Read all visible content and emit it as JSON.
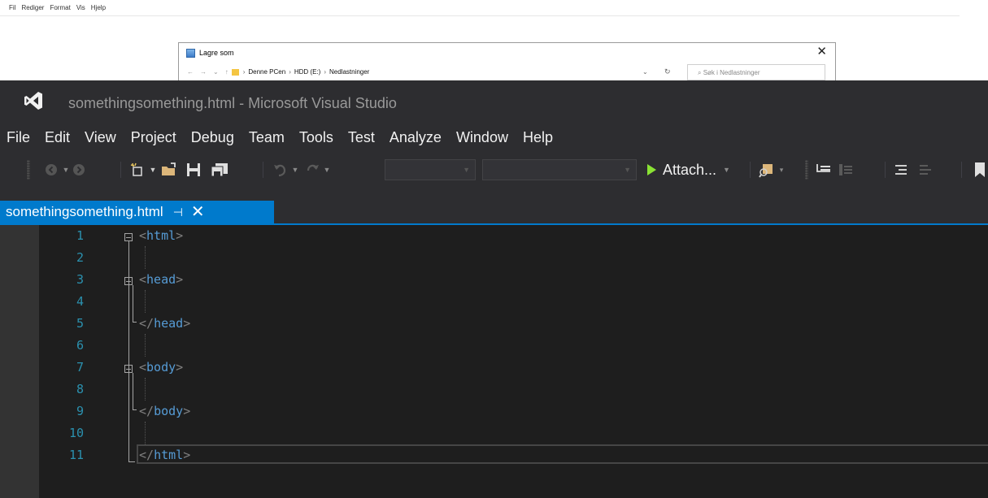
{
  "notepad": {
    "menu": [
      "Fil",
      "Rediger",
      "Format",
      "Vis",
      "Hjelp"
    ]
  },
  "save_dialog": {
    "title": "Lagre som",
    "close": "✕",
    "breadcrumb": [
      "Denne PCen",
      "HDD (E:)",
      "Nedlastninger"
    ],
    "search_placeholder": "Søk i Nedlastninger"
  },
  "vs": {
    "title": "somethingsomething.html - Microsoft Visual Studio",
    "menu": [
      "File",
      "Edit",
      "View",
      "Project",
      "Debug",
      "Team",
      "Tools",
      "Test",
      "Analyze",
      "Window",
      "Help"
    ],
    "toolbar": {
      "attach_label": "Attach...",
      "icons": [
        "back-icon",
        "forward-icon",
        "new-project-icon",
        "open-file-icon",
        "save-icon",
        "save-all-icon",
        "undo-icon",
        "redo-icon",
        "find-in-files-icon",
        "comment-icon",
        "uncomment-icon",
        "bookmark-icon"
      ]
    },
    "tab": {
      "label": "somethingsomething.html",
      "pin": "⊣",
      "close": "✕"
    },
    "editor": {
      "line_numbers": [
        "1",
        "2",
        "3",
        "4",
        "5",
        "6",
        "7",
        "8",
        "9",
        "10",
        "11"
      ],
      "lines": [
        {
          "open": "<",
          "tag": "html",
          "close": ">"
        },
        {
          "open": "",
          "tag": "",
          "close": ""
        },
        {
          "open": "<",
          "tag": "head",
          "close": ">"
        },
        {
          "open": "",
          "tag": "",
          "close": ""
        },
        {
          "open": "</",
          "tag": "head",
          "close": ">"
        },
        {
          "open": "",
          "tag": "",
          "close": ""
        },
        {
          "open": "<",
          "tag": "body",
          "close": ">"
        },
        {
          "open": "",
          "tag": "",
          "close": ""
        },
        {
          "open": "</",
          "tag": "body",
          "close": ">"
        },
        {
          "open": "",
          "tag": "",
          "close": ""
        },
        {
          "open": "</",
          "tag": "html",
          "close": ">"
        }
      ]
    }
  },
  "colors": {
    "accent": "#007acc",
    "line_number": "#2b91af",
    "tag": "#569cd6",
    "punctuation": "#808080",
    "editor_bg": "#1e1e1e",
    "chrome_bg": "#2d2d30"
  }
}
